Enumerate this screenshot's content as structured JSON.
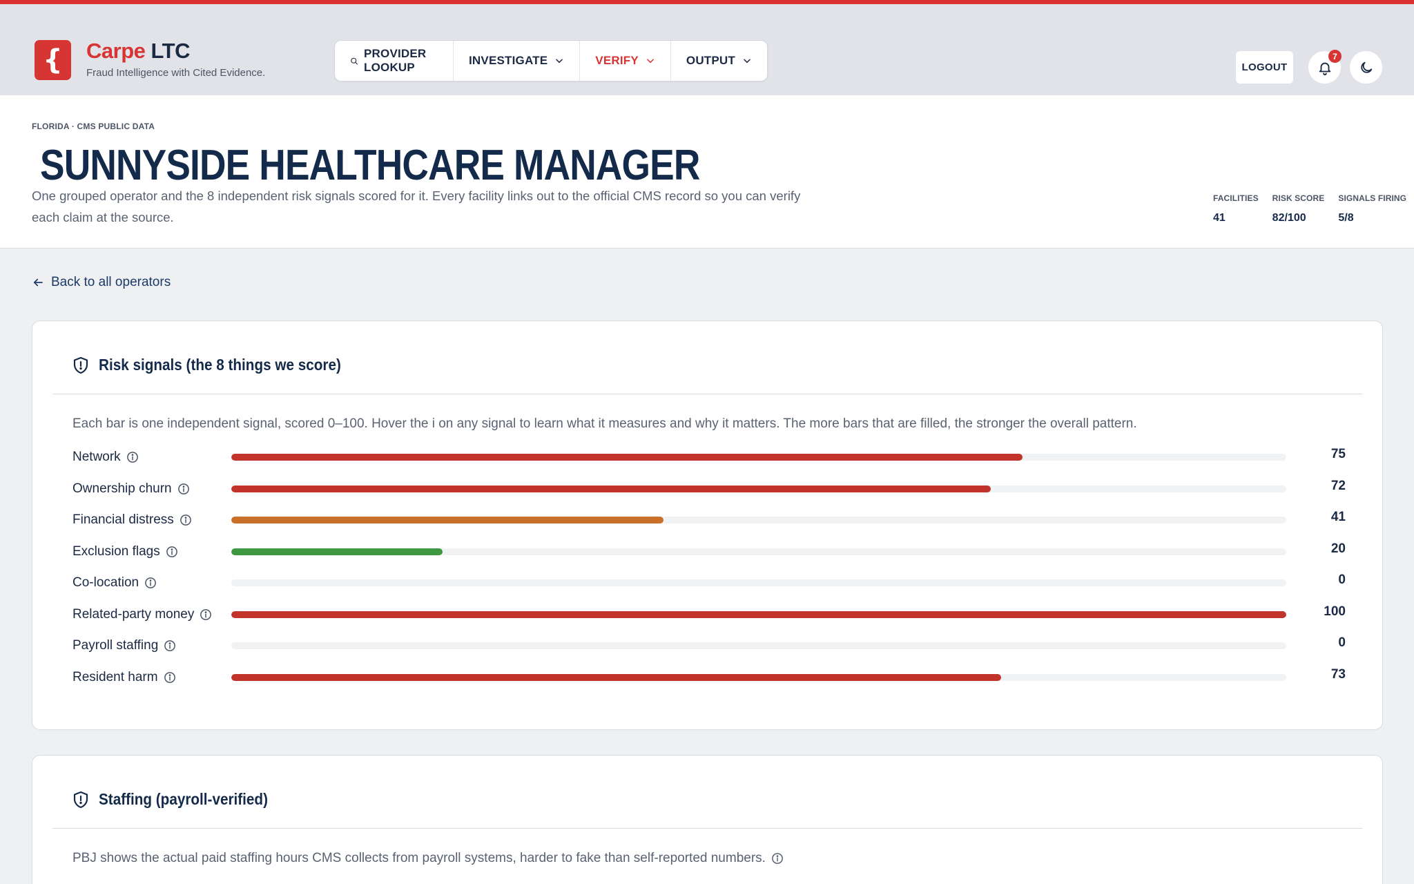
{
  "app": {
    "brand_part1": "Carpe",
    "brand_part2": "LTC",
    "logo_glyph": "{",
    "tagline": "Fraud Intelligence with Cited Evidence."
  },
  "nav": {
    "provider_lookup": "PROVIDER LOOKUP",
    "investigate": "INVESTIGATE",
    "verify": "VERIFY",
    "output": "OUTPUT",
    "active": "VERIFY"
  },
  "header_actions": {
    "logout": "LOGOUT",
    "notification_count": "7",
    "icons": [
      "bell-icon",
      "moon-icon"
    ]
  },
  "hero": {
    "eyebrow": "FLORIDA · CMS PUBLIC DATA",
    "title": "SUNNYSIDE HEALTHCARE MANAGER",
    "description": "One grouped operator and the 8 independent risk signals scored for it. Every facility links out to the official CMS record so you can verify each claim at the source.",
    "stats": [
      {
        "label": "FACILITIES",
        "value": "41"
      },
      {
        "label": "RISK SCORE",
        "value": "82/100"
      },
      {
        "label": "SIGNALS FIRING",
        "value": "5/8"
      }
    ]
  },
  "back_link": "Back to all operators",
  "risk_card": {
    "title": "Risk signals (the 8 things we score)",
    "description": "Each bar is one independent signal, scored 0–100. Hover the i on any signal to learn what it measures and why it matters. The more bars that are filled, the stronger the overall pattern.",
    "max": 100,
    "signals": [
      {
        "label": "Network",
        "value": 75,
        "color": "#c2342b"
      },
      {
        "label": "Ownership churn",
        "value": 72,
        "color": "#c2342b"
      },
      {
        "label": "Financial distress",
        "value": 41,
        "color": "#c8702a"
      },
      {
        "label": "Exclusion flags",
        "value": 20,
        "color": "#3e9842"
      },
      {
        "label": "Co-location",
        "value": 0,
        "color": "#c2342b"
      },
      {
        "label": "Related-party money",
        "value": 100,
        "color": "#c2342b"
      },
      {
        "label": "Payroll staffing",
        "value": 0,
        "color": "#c2342b"
      },
      {
        "label": "Resident harm",
        "value": 73,
        "color": "#c2342b"
      }
    ]
  },
  "staffing_card": {
    "title": "Staffing (payroll-verified)",
    "description": "PBJ shows the actual paid staffing hours CMS collects from payroll systems, harder to fake than self-reported numbers."
  },
  "colors": {
    "accent": "#d73434",
    "navy": "#142a4a",
    "high": "#c2342b",
    "medium": "#c8702a",
    "low": "#3e9842"
  }
}
